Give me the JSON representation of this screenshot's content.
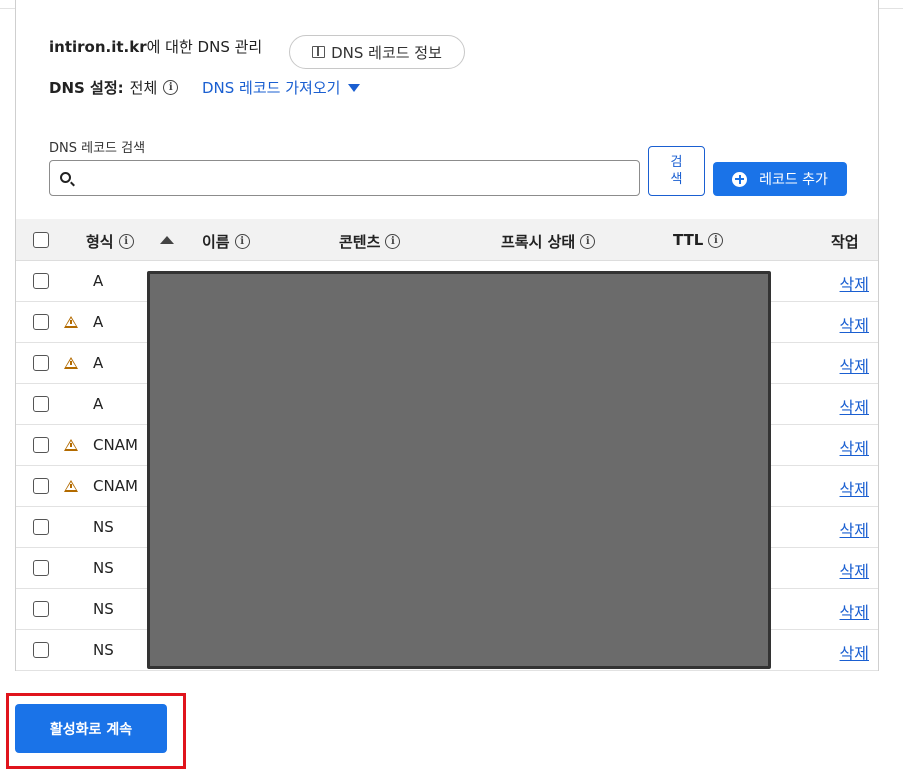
{
  "header": {
    "domain": "intiron.it.kr",
    "title_suffix": "에 대한 DNS 관리",
    "info_button": "DNS 레코드 정보",
    "settings_label": "DNS 설정:",
    "settings_value": "전체",
    "import_link": "DNS 레코드 가져오기"
  },
  "search": {
    "label": "DNS 레코드 검색",
    "placeholder": "",
    "button_line1": "검",
    "button_line2": "색",
    "add_button": "레코드 추가"
  },
  "table": {
    "columns": {
      "type": "형식",
      "name": "이름",
      "content": "콘텐츠",
      "proxy": "프록시 상태",
      "ttl": "TTL",
      "actions": "작업"
    },
    "rows": [
      {
        "type": "A",
        "warning": false,
        "action": "삭제"
      },
      {
        "type": "A",
        "warning": true,
        "action": "삭제"
      },
      {
        "type": "A",
        "warning": true,
        "action": "삭제"
      },
      {
        "type": "A",
        "warning": false,
        "action": "삭제"
      },
      {
        "type": "CNAM",
        "warning": true,
        "action": "삭제"
      },
      {
        "type": "CNAM",
        "warning": true,
        "action": "삭제"
      },
      {
        "type": "NS",
        "warning": false,
        "action": "삭제"
      },
      {
        "type": "NS",
        "warning": false,
        "action": "삭제"
      },
      {
        "type": "NS",
        "warning": false,
        "action": "삭제"
      },
      {
        "type": "NS",
        "warning": false,
        "action": "삭제"
      }
    ]
  },
  "footer": {
    "continue_button": "활성화로 계속"
  },
  "colors": {
    "accent": "#1a73e8",
    "link": "#1a5fd1",
    "warning": "#b36b00",
    "highlight": "#e0141c",
    "redaction": "#6b6b6b"
  },
  "icons": {
    "info": "info-circle-icon",
    "search": "search-icon",
    "add": "plus-circle-icon",
    "book": "book-icon",
    "warning": "warning-triangle-icon",
    "sort": "sort-up-icon",
    "dropdown": "caret-down-icon"
  }
}
